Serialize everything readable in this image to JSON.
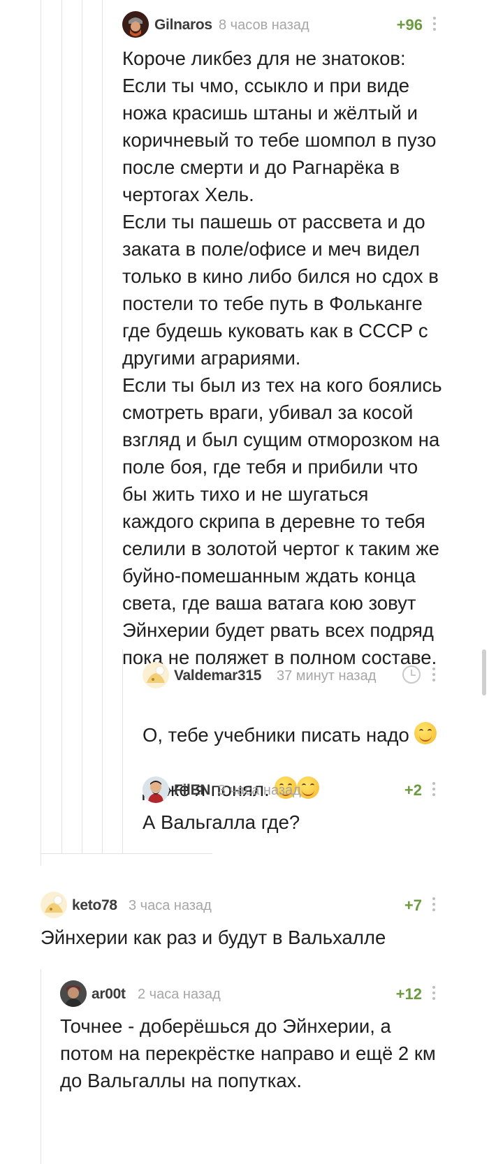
{
  "comments": [
    {
      "author": "Gilnaros",
      "time": "8 часов назад",
      "rating": "+96",
      "avatar_icon": "viking-avatar",
      "text": "Короче ликбез для не знатоков:\nЕсли ты чмо, ссыкло и при виде ножа красишь штаны и жёлтый и коричневый то тебе шомпол в пузо после смерти и до Рагнарёка в чертогах Хель.\nЕсли ты пашешь от рассвета и до заката в поле/офисе и меч видел только в кино либо бился но сдох в постели то тебе путь в Фольканге где будешь куковать как в СССР с другими аграриями.\nЕсли ты был из тех на кого боялись смотреть враги, убивал за косой взгляд и был сущим отморозком на поле боя, где тебя и прибили что бы жить тихо и не шугаться каждого скрипа в деревне то тебя селили в золотой чертог к таким же буйно-помешанным ждать конца света, где ваша ватага кою зовут Эйнхерии будет рвать всех подряд пока не поляжет в полном составе."
    },
    {
      "author": "Valdemar315",
      "time": "37 минут назад",
      "rating": "",
      "avatar_icon": "default-avatar",
      "text_line1": "О, тебе учебники писать надо",
      "text_line2": "Даже я понял."
    },
    {
      "author": "FilEN",
      "time": "3 часа назад",
      "rating": "+2",
      "avatar_icon": "bearded-avatar",
      "text": "А Вальгалла где?"
    },
    {
      "author": "keto78",
      "time": "3 часа назад",
      "rating": "+7",
      "avatar_icon": "default-avatar",
      "text": "Эйнхерии как раз и будут в Вальхалле"
    },
    {
      "author": "ar00t",
      "time": "2 часа назад",
      "rating": "+12",
      "avatar_icon": "portrait-avatar",
      "text": "Точнее - доберёшься до Эйнхерии, а потом на перекрёстке направо и ещё 2 км до Вальгаллы на попутках."
    }
  ],
  "colors": {
    "rating": "#6b9a3f",
    "time": "#a6a6a6",
    "author": "#3b3b3b",
    "thread_line": "#e3e3e3"
  }
}
